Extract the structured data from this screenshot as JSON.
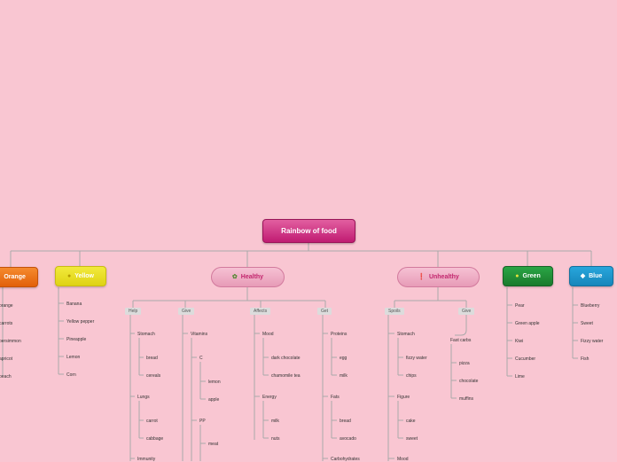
{
  "central": {
    "title": "Rainbow of food"
  },
  "branches": {
    "orange": {
      "label": "Orange",
      "icon": "orange-fruit-icon",
      "color": "#ef6c0e",
      "items": [
        "orange",
        "carrots",
        "persimmon",
        "apricot",
        "peach"
      ]
    },
    "yellow": {
      "label": "Yellow",
      "icon": "lemon-icon",
      "color": "#ece11e",
      "items": [
        "Banana",
        "Yellow pepper",
        "Pineapple",
        "Lemon",
        "Corn"
      ]
    },
    "healthy": {
      "label": "Healthy",
      "icon": "leaf-icon",
      "groups": {
        "help": {
          "label": "Help",
          "stomach": "Stomach",
          "stomach_items": [
            "bread",
            "cereals"
          ],
          "lungs": "Lungs",
          "lungs_items": [
            "carrot",
            "cabbage"
          ],
          "immunity": "Immunity"
        },
        "give": {
          "label": "Give",
          "vitamins": "Vitamins",
          "c": "C",
          "c_items": [
            "lemon",
            "apple"
          ],
          "pp": "PP",
          "pp_items": [
            "meat"
          ]
        },
        "affects": {
          "label": "Affects",
          "mood": "Mood",
          "mood_items": [
            "dark chocolate",
            "chamomile tea"
          ],
          "energy": "Energy",
          "energy_items": [
            "milk",
            "nuts"
          ]
        },
        "get": {
          "label": "Get",
          "proteins": "Proteins",
          "proteins_items": [
            "egg",
            "milk"
          ],
          "fats": "Fats",
          "fats_items": [
            "bread",
            "avocado"
          ],
          "carbohydrates": "Carbohydrates"
        }
      }
    },
    "unhealthy": {
      "label": "Unhealthy",
      "icon": "exclamation-icon",
      "groups": {
        "spoils": {
          "label": "Spoils",
          "stomach": "Stomach",
          "stomach_items": [
            "fizzy water",
            "chips"
          ],
          "figure": "Figure",
          "figure_items": [
            "cake",
            "sweet"
          ],
          "mood": "Mood"
        },
        "give": {
          "label": "Give",
          "fast_carbs": "Fast carbs",
          "fast_carbs_items": [
            "pizza",
            "chocolate",
            "muffins"
          ]
        }
      }
    },
    "green": {
      "label": "Green",
      "icon": "lime-icon",
      "color": "#1e8a33",
      "items": [
        "Pear",
        "Green apple",
        "Kiwi",
        "Cucumber",
        "Lime"
      ]
    },
    "blue": {
      "label": "Blue",
      "icon": "fish-icon",
      "color": "#1991c8",
      "items": [
        "Blueberry",
        "Sweet",
        "Fizzy water",
        "Fish"
      ]
    }
  }
}
